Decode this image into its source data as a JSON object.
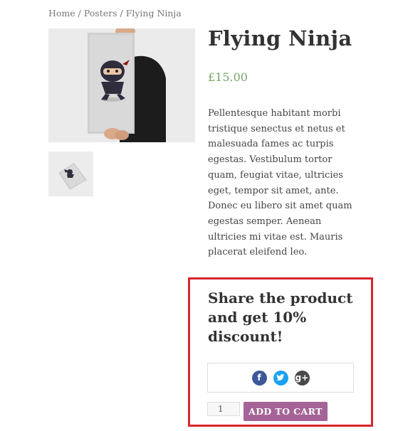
{
  "breadcrumb": {
    "items": [
      "Home",
      "Posters",
      "Flying Ninja"
    ],
    "separator": " / "
  },
  "product": {
    "title": "Flying Ninja",
    "price": "£15.00",
    "description": "Pellentesque habitant morbi tristique senectus et netus et malesuada fames ac turpis egestas. Vestibulum tortor quam, feugiat vitae, ultricies eget, tempor sit amet, ante. Donec eu libero sit amet quam egestas semper. Aenean ultricies mi vitae est. Mauris placerat eleifend leo."
  },
  "gallery": {
    "main_image": "ninja-poster-photo",
    "thumbnail": "ninja-poster-thumbnail"
  },
  "share": {
    "heading": "Share the product and get 10% discount!",
    "icons": [
      "facebook-icon",
      "twitter-icon",
      "google-plus-icon"
    ],
    "highlight_color": "#d9262e"
  },
  "cart": {
    "quantity": "1",
    "add_label": "ADD TO CART",
    "button_color": "#a46497"
  },
  "colors": {
    "price": "#77a464",
    "facebook": "#3b5998",
    "twitter": "#1da1f2",
    "google_plus": "#4a4a4a"
  }
}
